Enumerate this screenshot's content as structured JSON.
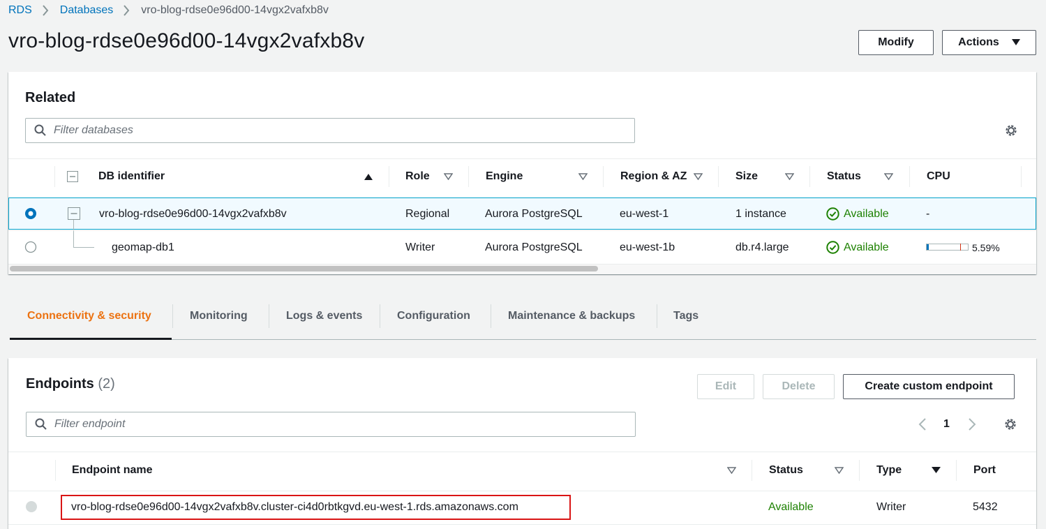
{
  "breadcrumb": {
    "items": [
      "RDS",
      "Databases"
    ],
    "current": "vro-blog-rdse0e96d00-14vgx2vafxb8v"
  },
  "page": {
    "title": "vro-blog-rdse0e96d00-14vgx2vafxb8v",
    "modify_label": "Modify",
    "actions_label": "Actions"
  },
  "related": {
    "title": "Related",
    "filter_placeholder": "Filter databases",
    "columns": [
      "DB identifier",
      "Role",
      "Engine",
      "Region & AZ",
      "Size",
      "Status",
      "CPU"
    ],
    "rows": [
      {
        "id": "vro-blog-rdse0e96d00-14vgx2vafxb8v",
        "role": "Regional",
        "engine": "Aurora PostgreSQL",
        "region": "eu-west-1",
        "size": "1 instance",
        "status": "Available",
        "cpu": "-"
      },
      {
        "id": "geomap-db1",
        "role": "Writer",
        "engine": "Aurora PostgreSQL",
        "region": "eu-west-1b",
        "size": "db.r4.large",
        "status": "Available",
        "cpu": "5.59%",
        "cpu_fraction": 0.0559
      }
    ]
  },
  "tabs": [
    "Connectivity & security",
    "Monitoring",
    "Logs & events",
    "Configuration",
    "Maintenance & backups",
    "Tags"
  ],
  "endpoints": {
    "title": "Endpoints",
    "count": "(2)",
    "edit_label": "Edit",
    "delete_label": "Delete",
    "create_label": "Create custom endpoint",
    "filter_placeholder": "Filter endpoint",
    "page_number": "1",
    "columns": [
      "Endpoint name",
      "Status",
      "Type",
      "Port"
    ],
    "rows": [
      {
        "name": "vro-blog-rdse0e96d00-14vgx2vafxb8v.cluster-ci4d0rbtkgvd.eu-west-1.rds.amazonaws.com",
        "status": "Available",
        "type": "Writer",
        "port": "5432"
      }
    ]
  },
  "colors": {
    "link": "#0073bb",
    "accent": "#ec7211",
    "success": "#1d8102",
    "highlight_border": "#d91515"
  }
}
